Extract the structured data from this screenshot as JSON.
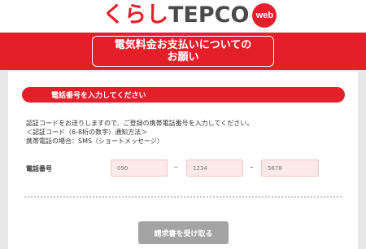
{
  "brand": {
    "logo_prefix": "くらし",
    "logo_main": "TEPCO",
    "logo_badge": "web",
    "accent_color": "#e3202a"
  },
  "banner": {
    "title": "電気料金お支払いについての\nお願い"
  },
  "section": {
    "heading": "電話番号を入力してください"
  },
  "instructions": [
    "認証コードをお送りしますので、ご登録の携帯電話番号を入力してください。",
    "＜認証コード（6-8桁の数字）通知方法＞",
    "携帯電話の場合：SMS（ショートメッセージ）"
  ],
  "phone": {
    "label": "電話番号",
    "part1_placeholder": "090",
    "part2_placeholder": "1234",
    "part3_placeholder": "5678",
    "separator": "–"
  },
  "submit": {
    "label": "請求書を受け取る"
  }
}
